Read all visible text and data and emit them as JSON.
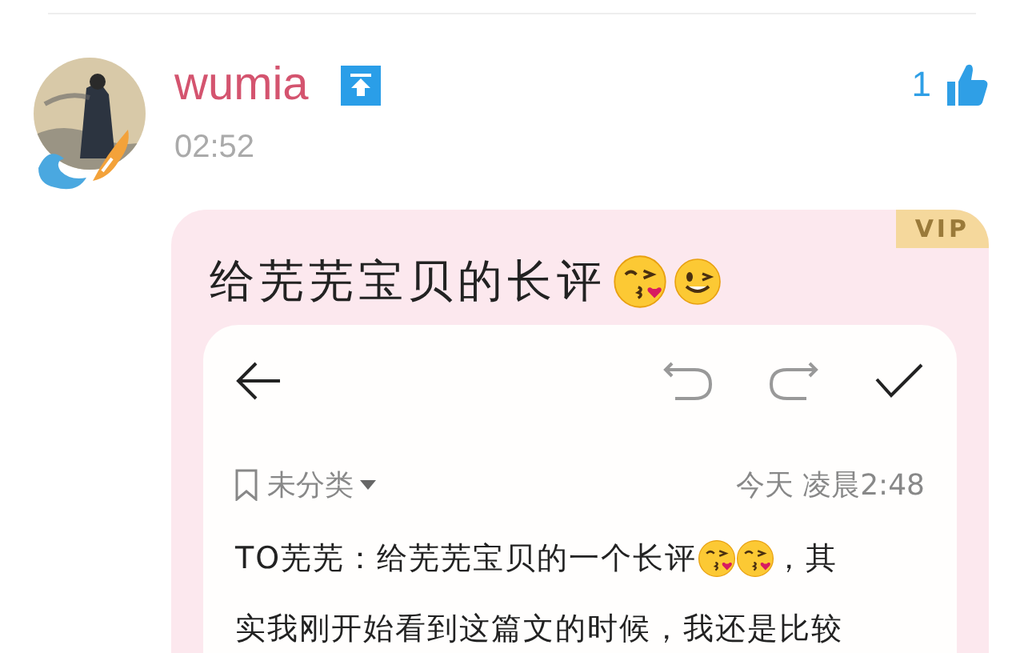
{
  "comment": {
    "username": "wumia",
    "time": "02:52",
    "likes": "1",
    "liked": true
  },
  "post": {
    "badge": "VIP",
    "title": "给芜芜宝贝的长评",
    "note": {
      "category": "未分类",
      "date": "今天 凌晨2:48",
      "body_line1_before": "TO芜芜：给芜芜宝贝的一个长评",
      "body_line1_after": "，其",
      "body_line2": "实我刚开始看到这篇文的时候，我还是比较"
    }
  }
}
